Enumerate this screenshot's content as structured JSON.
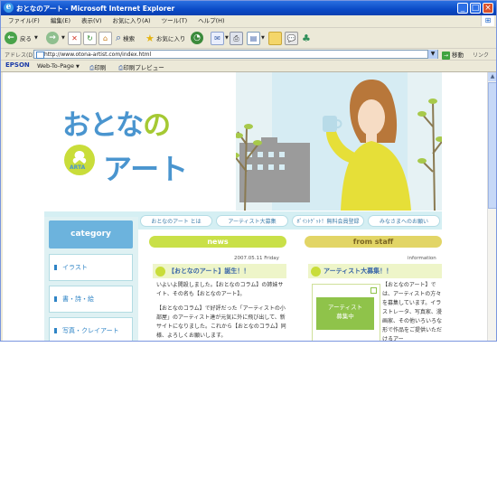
{
  "window": {
    "title": "おとなのアート - Microsoft Internet Explorer"
  },
  "menu": [
    "ファイル(F)",
    "編集(E)",
    "表示(V)",
    "お気に入り(A)",
    "ツール(T)",
    "ヘルプ(H)"
  ],
  "toolbar": {
    "back_label": "戻る",
    "search_label": "検索",
    "favorites_label": "お気に入り"
  },
  "address": {
    "label": "アドレス(D)",
    "url": "http://www.otona-artist.com/index.html",
    "go_label": "移動",
    "links_label": "リンク"
  },
  "epson_bar": {
    "brand": "EPSON",
    "web_to_page": "Web-To-Page",
    "print_label": "印刷",
    "preview_label": "印刷プレビュー"
  },
  "site": {
    "logo_line1_a": "おとな",
    "logo_line1_b": "の",
    "logo_line2": "アート",
    "logo_seal_text": "ARTA",
    "nav": [
      "おとなのアート とは",
      "アーティスト大募集",
      "ﾎﾟｲﾝﾄｹﾞｯﾄ！無料会員登録",
      "みなさまへのお願い"
    ],
    "category_title": "category",
    "categories": [
      "イラスト",
      "書・詩・絵",
      "写真・クレイアート"
    ],
    "news": {
      "title": "news",
      "date": "2007.05.11 Friday",
      "headline": "【おとなのアート】誕生！！",
      "body1": "いよいよ開設しました。【おとなのコラム】の姉妹サイト、その名も【おとなのアート】。",
      "body2": "【おとなのコラム】で好評だった「アーティストの小部屋」のアーティスト達が元気に外に飛び出して、新サイトになりました。これから【おとなのコラム】同様、よろしくお願いします。"
    },
    "staff": {
      "title": "from staff",
      "tag": "information",
      "headline": "アーティスト大募集！！",
      "box_line1": "アーティスト",
      "box_line2": "募集中",
      "body": "【おとなのアート】では、アーティストの方々を募集しています。イラストレータ、写真家、漫画家、その他いろいろな形で作品をご提供いただけるアー"
    }
  },
  "colors": {
    "title_bar": "#0a4ac6",
    "logo_blue": "#4a95cf",
    "logo_green": "#a5c933",
    "news_green": "#c9e048",
    "staff_yellow": "#e2d566",
    "category_blue": "#6cb3dd"
  }
}
